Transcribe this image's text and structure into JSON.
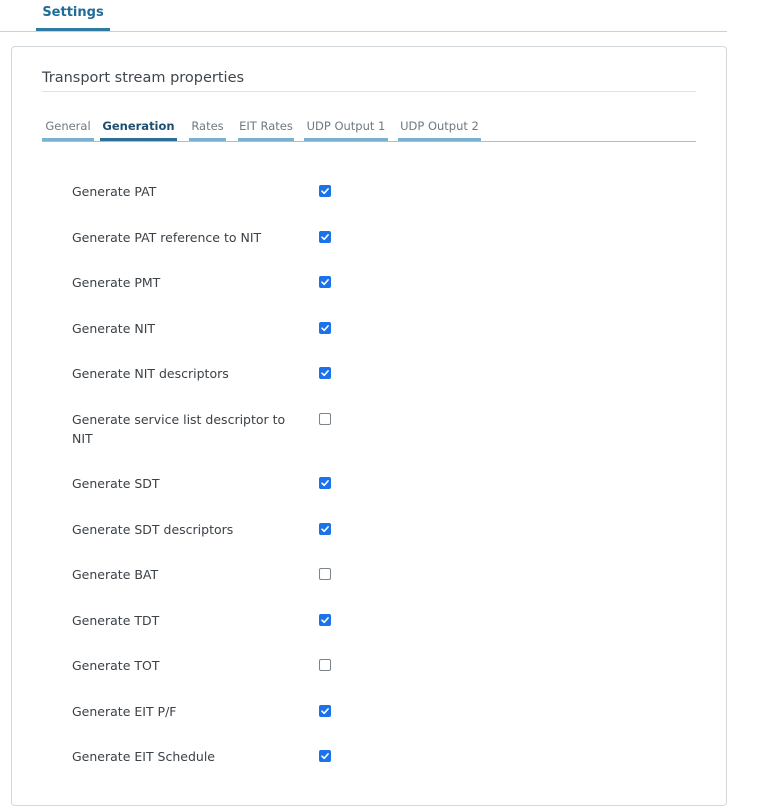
{
  "top_tabs": [
    {
      "label": "Settings",
      "active": true
    }
  ],
  "panel": {
    "title": "Transport stream properties",
    "subtabs": [
      {
        "label": "General",
        "active": false
      },
      {
        "label": "Generation",
        "active": true
      },
      {
        "label": "Rates",
        "active": false
      },
      {
        "label": "EIT Rates",
        "active": false
      },
      {
        "label": "UDP Output 1",
        "active": false
      },
      {
        "label": "UDP Output 2",
        "active": false
      }
    ],
    "options": [
      {
        "label": "Generate PAT",
        "checked": true
      },
      {
        "label": "Generate PAT reference to NIT",
        "checked": true
      },
      {
        "label": "Generate PMT",
        "checked": true
      },
      {
        "label": "Generate NIT",
        "checked": true
      },
      {
        "label": "Generate NIT descriptors",
        "checked": true
      },
      {
        "label": "Generate service list descriptor to NIT",
        "checked": false
      },
      {
        "label": "Generate SDT",
        "checked": true
      },
      {
        "label": "Generate SDT descriptors",
        "checked": true
      },
      {
        "label": "Generate BAT",
        "checked": false
      },
      {
        "label": "Generate TDT",
        "checked": true
      },
      {
        "label": "Generate TOT",
        "checked": false
      },
      {
        "label": "Generate EIT P/F",
        "checked": true
      },
      {
        "label": "Generate EIT Schedule",
        "checked": true
      }
    ]
  },
  "colors": {
    "accent": "#1a73e8",
    "tab_active": "#2d6f96",
    "tab_inactive": "#79b2cf"
  }
}
